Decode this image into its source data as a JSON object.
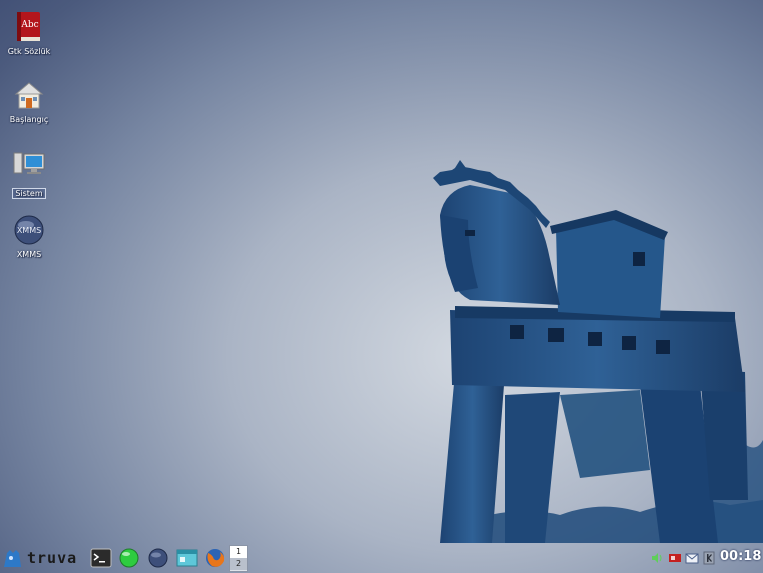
{
  "desktop": {
    "icons": [
      {
        "label": "Gtk Sözlük",
        "icon": "dictionary-book-icon"
      },
      {
        "label": "Başlangıç",
        "icon": "home-icon"
      },
      {
        "label": "Sistem",
        "icon": "computer-icon"
      },
      {
        "label": "XMMS",
        "icon": "xmms-player-icon"
      }
    ]
  },
  "panel": {
    "menu_logo_text": "truva",
    "launchers": [
      {
        "icon": "terminal-icon"
      },
      {
        "icon": "network-globe-icon"
      },
      {
        "icon": "xmms-player-icon"
      },
      {
        "icon": "file-manager-icon"
      },
      {
        "icon": "firefox-icon"
      }
    ],
    "pager": {
      "pages": [
        "1",
        "2"
      ],
      "active": "1"
    },
    "tray": [
      {
        "icon": "volume-icon"
      },
      {
        "icon": "network-status-icon"
      },
      {
        "icon": "mail-icon"
      },
      {
        "icon": "keyboard-layout-icon"
      }
    ],
    "clock": "00:18"
  },
  "colors": {
    "wallpaper_dark": "#3b4970",
    "wallpaper_light": "#d3d9e1",
    "horse": "#2a5586"
  }
}
